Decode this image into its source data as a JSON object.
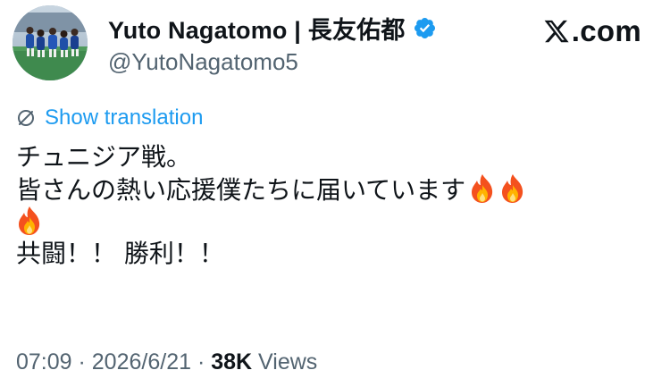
{
  "author": {
    "display_name": "Yuto Nagatomo | 長友佑都",
    "handle": "@YutoNagatomo5",
    "verified": true
  },
  "source": {
    "domain": ".com",
    "logo_icon": "x-logo-icon"
  },
  "translate": {
    "icon": "translate-icon",
    "label": "Show translation"
  },
  "tweet": {
    "lines": [
      "チュニジア戦。",
      "皆さんの熱い応援僕たちに届いています",
      "",
      "共闘！！ 勝利！！"
    ],
    "emoji": "fire-icon"
  },
  "meta": {
    "time": "07:09",
    "separator": " · ",
    "date": "2026/6/21",
    "views_count": "38K",
    "views_label": " Views"
  },
  "colors": {
    "accent": "#1d9bf0",
    "text_primary": "#0f1419",
    "text_secondary": "#536471"
  }
}
